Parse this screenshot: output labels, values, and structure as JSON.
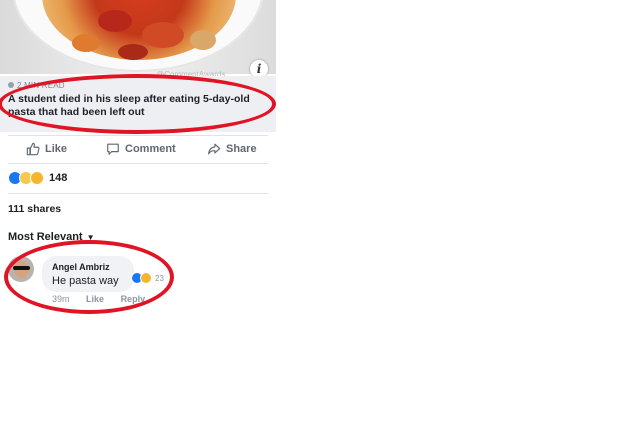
{
  "post": {
    "image_watermark": "@CommentAwards",
    "info_icon": "info-icon",
    "link_meta": "2 MIN READ",
    "headline": "A student died in his sleep after eating 5-day-old pasta that had been left out"
  },
  "actions": {
    "like_label": "Like",
    "comment_label": "Comment",
    "share_label": "Share"
  },
  "stats": {
    "reaction_icons": [
      "like-icon",
      "wow-icon",
      "haha-icon"
    ],
    "reaction_count": "148",
    "shares": "111 shares"
  },
  "comments": {
    "sort_label": "Most Relevant",
    "first": {
      "author": "Angel Ambriz",
      "text": "He pasta way",
      "time": "39m",
      "like_label": "Like",
      "reply_label": "Reply",
      "reaction_count": "23"
    }
  },
  "colors": {
    "annotation_red": "#e01424",
    "facebook_blue": "#1877f2",
    "link_box_bg": "#eeeff2"
  }
}
